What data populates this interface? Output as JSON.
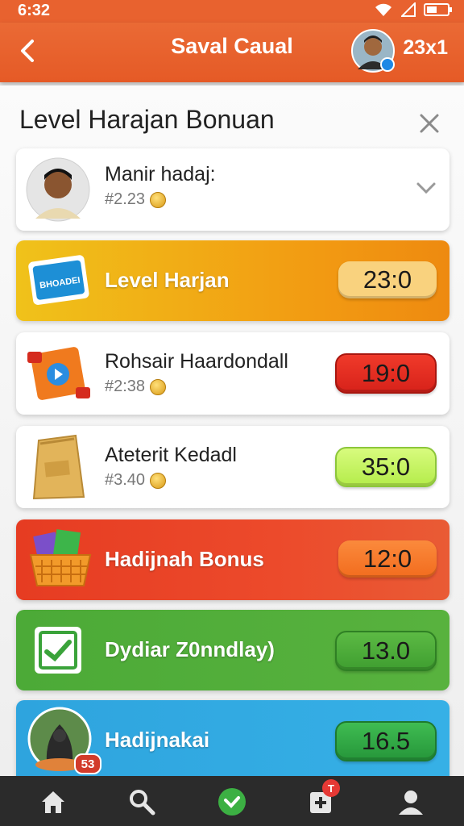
{
  "status": {
    "time": "6:32"
  },
  "header": {
    "title": "Saval Caual",
    "counter": "23x1"
  },
  "panel": {
    "title": "Level Harajan Bonuan",
    "user": {
      "name": "Manir hadaj:",
      "sub": "#2.23"
    }
  },
  "rows": [
    {
      "name": "Level Harjan",
      "value": "23:0",
      "icon_label": "BHOADEI"
    },
    {
      "name": "Rohsair Haardondall",
      "sub": "#2:38",
      "value": "19:0"
    },
    {
      "name": "Ateterit Kedadl",
      "sub": "#3.40",
      "value": "35:0"
    },
    {
      "name": "Hadijnah Bonus",
      "value": "12:0"
    },
    {
      "name": "Dydiar Z0nndlay)",
      "value": "13.0"
    },
    {
      "name": "Hadijnakai",
      "value": "16.5",
      "badge": "53"
    }
  ],
  "colors": {
    "brand": "#e8622f",
    "nav": "#2b2b2b",
    "accent": "#3cb043"
  },
  "nav": [
    "home-icon",
    "search-icon",
    "check-icon",
    "add-notification-icon",
    "profile-icon"
  ],
  "nav_badge": "T"
}
